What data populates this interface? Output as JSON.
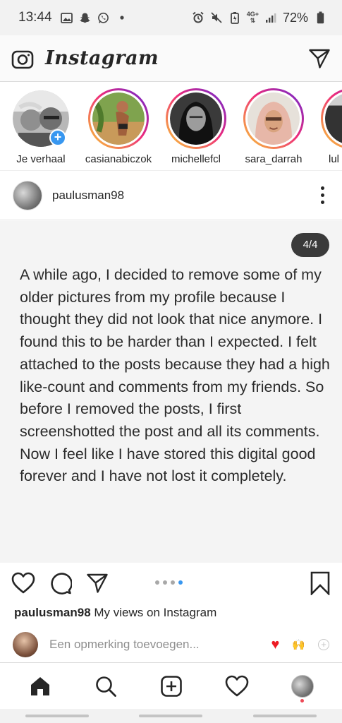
{
  "status_bar": {
    "time": "13:44",
    "battery": "72%",
    "network": "4G+"
  },
  "app": {
    "title": "Instagram"
  },
  "stories": [
    {
      "label": "Je verhaal",
      "own": true
    },
    {
      "label": "casianabiczok"
    },
    {
      "label": "michellefcl"
    },
    {
      "label": "sara_darrah"
    },
    {
      "label": "lul"
    }
  ],
  "post": {
    "username": "paulusman98",
    "counter": "4/4",
    "text": "A while ago, I decided to remove some of my older pictures from my profile because I thought they did not look that nice anymore. I found this to be harder than I expected. I felt attached to the posts because they had a high like-count and comments from my friends. So before I removed the posts, I first screenshotted the post and all its comments. Now I feel like I have stored this digital good forever and I have not lost it completely.",
    "carousel_index": 4,
    "carousel_total": 4,
    "caption_user": "paulusman98",
    "caption_text": "My views on Instagram"
  },
  "comment": {
    "placeholder": "Een opmerking toevoegen..."
  },
  "colors": {
    "accent": "#3897f0",
    "notification": "#ed4956"
  }
}
